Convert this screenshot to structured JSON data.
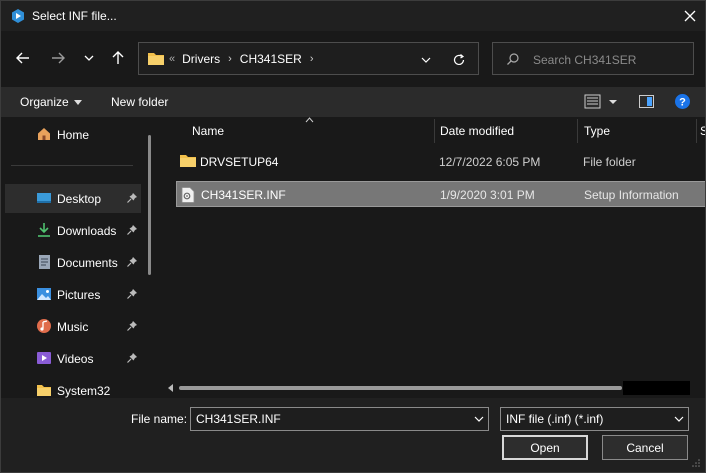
{
  "window": {
    "title": "Select INF file..."
  },
  "nav": {
    "breadcrumb": [
      "Drivers",
      "CH341SER"
    ],
    "overflow_glyph": "«"
  },
  "search": {
    "placeholder": "Search CH341SER"
  },
  "toolbar": {
    "organize": "Organize",
    "new_folder": "New folder"
  },
  "sidebar": {
    "items": [
      {
        "label": "Home",
        "icon": "home-icon",
        "pinned": false
      },
      {
        "label": "Desktop",
        "icon": "desktop-icon",
        "pinned": true,
        "selected": true
      },
      {
        "label": "Downloads",
        "icon": "downloads-icon",
        "pinned": true
      },
      {
        "label": "Documents",
        "icon": "documents-icon",
        "pinned": true
      },
      {
        "label": "Pictures",
        "icon": "pictures-icon",
        "pinned": true
      },
      {
        "label": "Music",
        "icon": "music-icon",
        "pinned": true
      },
      {
        "label": "Videos",
        "icon": "videos-icon",
        "pinned": true
      },
      {
        "label": "System32",
        "icon": "folder-icon",
        "pinned": false
      }
    ]
  },
  "columns": {
    "name": "Name",
    "date": "Date modified",
    "type": "Type",
    "size": "S"
  },
  "files": [
    {
      "name": "DRVSETUP64",
      "date": "12/7/2022 6:05 PM",
      "type": "File folder",
      "icon": "folder-icon",
      "selected": false
    },
    {
      "name": "CH341SER.INF",
      "date": "1/9/2020 3:01 PM",
      "type": "Setup Information",
      "icon": "setup-file-icon",
      "selected": true
    }
  ],
  "bottom": {
    "file_name_label": "File name:",
    "file_name_value": "CH341SER.INF",
    "filter": "INF file (.inf) (*.inf)",
    "open": "Open",
    "cancel": "Cancel"
  },
  "colors": {
    "selected_row": "#777777",
    "help_blue": "#1a73e8",
    "folder_yellow": "#f2c04b"
  }
}
